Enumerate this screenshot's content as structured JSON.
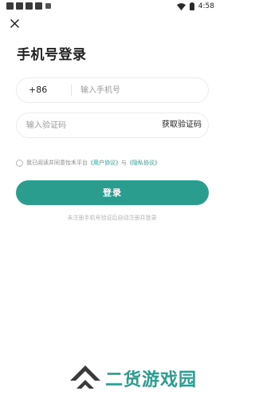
{
  "status_bar": {
    "time": "4:58",
    "icons": [
      "notification-square-icon",
      "notification-square-icon",
      "notification-square-icon",
      "notification-square-icon",
      "small-square-icon",
      "wifi-icon",
      "battery-icon"
    ]
  },
  "header": {
    "close_icon": "close-icon"
  },
  "title": "手机号登录",
  "phone": {
    "country_code": "+86",
    "placeholder": "输入手机号",
    "value": ""
  },
  "code": {
    "placeholder": "输入验证码",
    "value": "",
    "get_code_label": "获取验证码"
  },
  "agreement": {
    "checked": false,
    "prefix": "我已阅读并同意怡禾平台",
    "user_agreement": "《用户协议》",
    "and": "与",
    "privacy_agreement": "《隐私协议》"
  },
  "login_button": "登录",
  "hint": "未注册手机号验证后自动注册并登录",
  "watermark": {
    "text": "二货游戏园",
    "logo_icon": "chevron-logo-icon"
  },
  "colors": {
    "accent": "#2a9d8f",
    "text": "#222222",
    "placeholder": "#9a9a9a",
    "hint": "#b3b3b3"
  }
}
